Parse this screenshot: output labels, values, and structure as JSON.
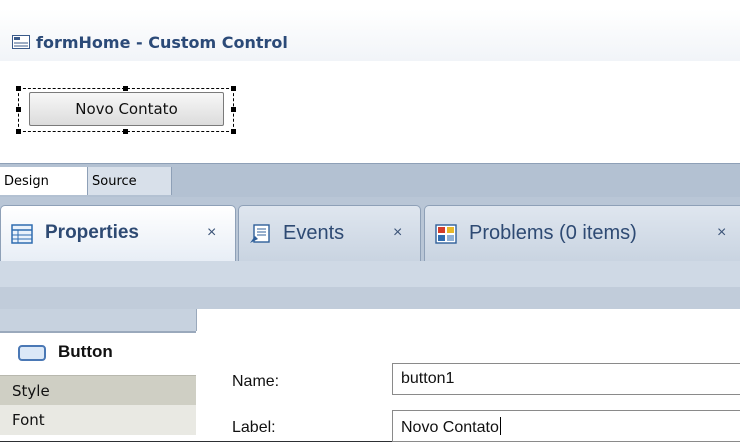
{
  "editor": {
    "title": "formHome - Custom Control",
    "canvas_button_label": "Novo Contato"
  },
  "mode_tabs": [
    {
      "label": "Design",
      "active": true
    },
    {
      "label": "Source",
      "active": false
    }
  ],
  "view_tabs": [
    {
      "label": "Properties",
      "icon": "properties-icon",
      "active": true,
      "close": "×"
    },
    {
      "label": "Events",
      "icon": "events-icon",
      "active": false,
      "close": "×"
    },
    {
      "label": "Problems (0 items)",
      "icon": "problems-icon",
      "active": false,
      "close": "×"
    }
  ],
  "properties": {
    "category_header": "Button",
    "categories": [
      "Style",
      "Font"
    ],
    "fields": {
      "name_label": "Name:",
      "name_value": "button1",
      "label_label": "Label:",
      "label_value": "Novo Contato"
    }
  },
  "colors": {
    "title_text": "#2b4a78",
    "tab_text": "#2e4a73",
    "panel_blue": "#b3c1d2"
  }
}
